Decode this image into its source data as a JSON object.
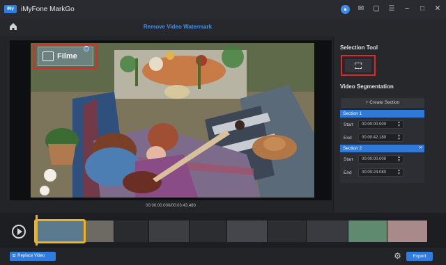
{
  "app": {
    "logo_text": "iMy",
    "title": "iMyFone MarkGo"
  },
  "header": {
    "page_title": "Remove Video Watermark"
  },
  "preview": {
    "watermark_text": "Filme",
    "time": "00:00:00.000/00:03:43.480"
  },
  "side": {
    "selection_tool_title": "Selection Tool",
    "segmentation_title": "Video Segmentation",
    "create_section_label": "+ Create Section",
    "sections": [
      {
        "name": "Section 1",
        "start_label": "Start",
        "start": "00:00:00.000",
        "end_label": "End",
        "end": "00:00:42.180"
      },
      {
        "name": "Section 2",
        "start_label": "Start",
        "start": "00:00:00.000",
        "end_label": "End",
        "end": "00:00:24.080"
      }
    ]
  },
  "bottom": {
    "replace_label": "Replace Video",
    "export_label": "Export"
  },
  "colors": {
    "accent": "#2f7de1",
    "highlight_red": "#e0272a",
    "timeline_yellow": "#f3b118"
  },
  "icons": [
    "home-icon",
    "user-icon",
    "mail-icon",
    "chat-icon",
    "menu-icon",
    "minimize-icon",
    "maximize-icon",
    "close-icon",
    "crop-icon",
    "play-icon",
    "gear-icon"
  ]
}
